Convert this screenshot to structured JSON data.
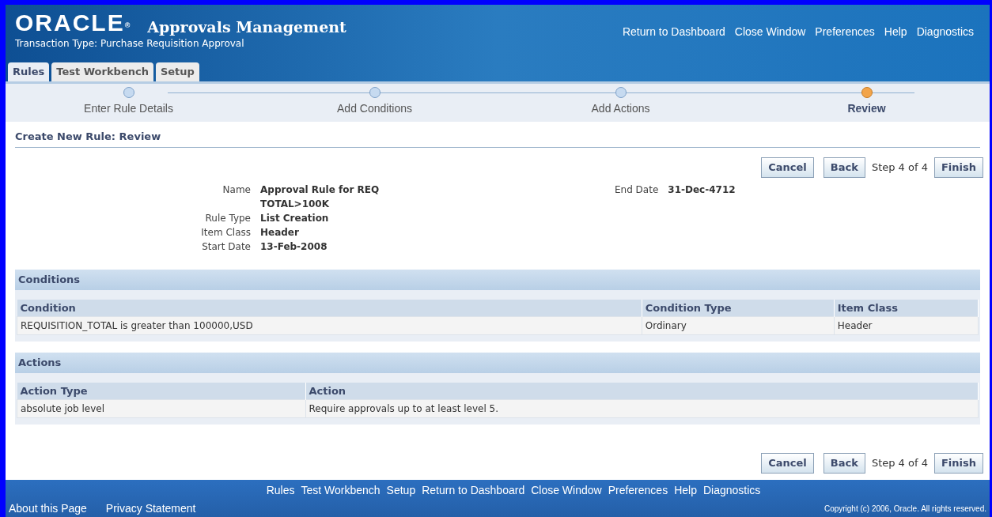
{
  "header": {
    "logo": "ORACLE",
    "logo_mark": "®",
    "app_title": "Approvals Management",
    "subtitle": "Transaction Type: Purchase Requisition Approval",
    "global_links": [
      "Return to Dashboard",
      "Close Window",
      "Preferences",
      "Help",
      "Diagnostics"
    ]
  },
  "tabs": [
    {
      "label": "Rules",
      "selected": true
    },
    {
      "label": "Test Workbench",
      "selected": false
    },
    {
      "label": "Setup",
      "selected": false
    }
  ],
  "train": [
    {
      "label": "Enter Rule Details",
      "selected": false
    },
    {
      "label": "Add Conditions",
      "selected": false
    },
    {
      "label": "Add Actions",
      "selected": false
    },
    {
      "label": "Review",
      "selected": true
    }
  ],
  "page_title": "Create New Rule: Review",
  "nav_top": {
    "cancel": "Cancel",
    "back": "Back",
    "step": "Step 4 of 4",
    "finish": "Finish"
  },
  "details_left": [
    {
      "label": "Name",
      "value": "Approval Rule for REQ TOTAL>100K"
    },
    {
      "label": "Rule Type",
      "value": "List Creation"
    },
    {
      "label": "Item Class",
      "value": "Header"
    },
    {
      "label": "Start Date",
      "value": "13-Feb-2008"
    }
  ],
  "details_right": [
    {
      "label": "End Date",
      "value": "31-Dec-4712"
    }
  ],
  "conditions": {
    "title": "Conditions",
    "columns": [
      "Condition",
      "Condition Type",
      "Item Class"
    ],
    "rows": [
      [
        "REQUISITION_TOTAL is greater than 100000,USD",
        "Ordinary",
        "Header"
      ]
    ]
  },
  "actions": {
    "title": "Actions",
    "columns": [
      "Action Type",
      "Action"
    ],
    "rows": [
      [
        "absolute job level",
        "Require approvals up to at least level 5."
      ]
    ]
  },
  "nav_bottom": {
    "cancel": "Cancel",
    "back": "Back",
    "step": "Step 4 of 4",
    "finish": "Finish"
  },
  "footer": {
    "links": [
      "Rules",
      "Test Workbench",
      "Setup",
      "Return to Dashboard",
      "Close Window",
      "Preferences",
      "Help",
      "Diagnostics"
    ],
    "about": "About this Page",
    "privacy": "Privacy Statement",
    "copyright": "Copyright (c) 2006, Oracle. All rights reserved."
  }
}
